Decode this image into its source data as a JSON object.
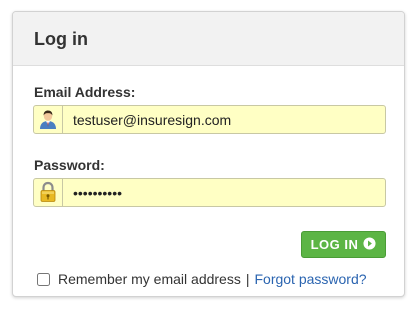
{
  "panel": {
    "title": "Log in"
  },
  "email": {
    "label": "Email Address:",
    "value": "testuser@insuresign.com",
    "icon": "user-icon"
  },
  "password": {
    "label": "Password:",
    "value": "••••••••••",
    "icon": "lock-icon"
  },
  "login_button": {
    "label": "LOG IN",
    "icon": "arrow-circle-right-icon",
    "color": "#5cb545"
  },
  "remember": {
    "label": "Remember my email address",
    "checked": false
  },
  "separator": "|",
  "forgot_link": "Forgot password?",
  "colors": {
    "field_background": "#ffffc4",
    "header_background": "#f2f2f2",
    "link": "#2a64b0"
  }
}
